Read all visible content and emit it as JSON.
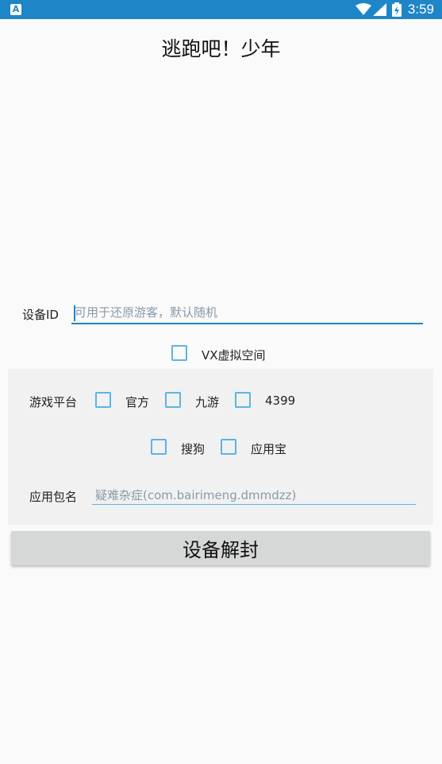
{
  "status_bar": {
    "app_icon_letter": "A",
    "time": "3:59",
    "icons": [
      "wifi-icon",
      "signal-icon",
      "battery-charging-icon"
    ]
  },
  "app": {
    "title": "逃跑吧！少年"
  },
  "device": {
    "label": "设备ID",
    "input_value": "",
    "placeholder": "可用于还原游客，默认随机"
  },
  "vx_space": {
    "label": "VX虚拟空间",
    "checked": false
  },
  "platform": {
    "label": "游戏平台",
    "options": [
      {
        "label": "官方",
        "checked": false
      },
      {
        "label": "九游",
        "checked": false
      },
      {
        "label": "4399",
        "checked": false
      },
      {
        "label": "搜狗",
        "checked": false
      },
      {
        "label": "应用宝",
        "checked": false
      }
    ]
  },
  "package": {
    "label": "应用包名",
    "input_value": "",
    "placeholder": "疑难杂症(com.bairimeng.dmmdzz)"
  },
  "actions": {
    "unlock_label": "设备解封"
  },
  "colors": {
    "status_bar": "#1e86c7",
    "accent": "#1e86c7",
    "checkbox_border": "#5ab4e6",
    "panel_bg": "#f1f1f1",
    "button_bg": "#d6d7d7"
  }
}
